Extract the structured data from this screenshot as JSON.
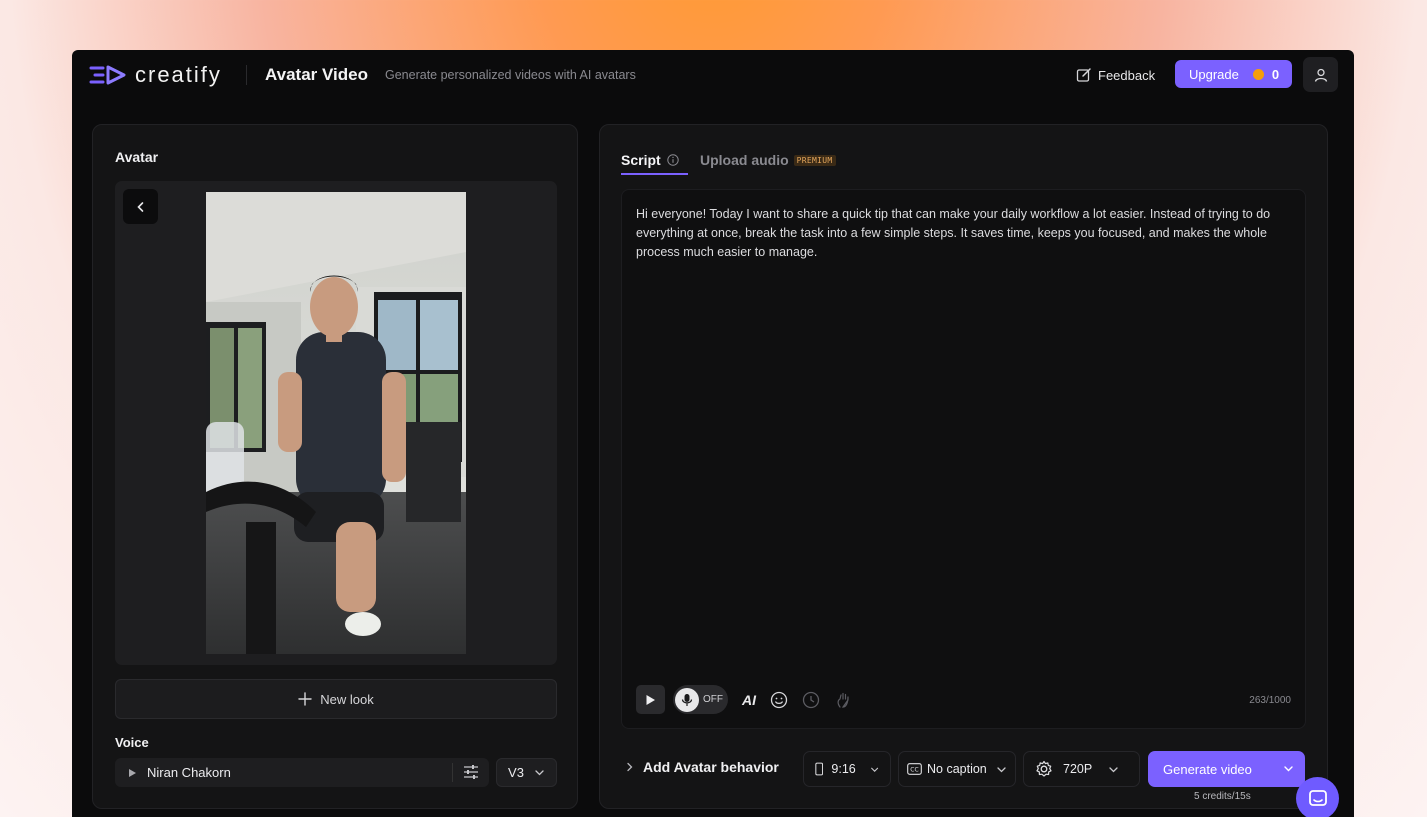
{
  "header": {
    "logo_text": "creatify",
    "title": "Avatar Video",
    "subtitle": "Generate personalized videos with AI avatars",
    "feedback_label": "Feedback",
    "upgrade_label": "Upgrade",
    "credits_count": "0"
  },
  "left": {
    "avatar_label": "Avatar",
    "new_look_label": "New look",
    "voice_label": "Voice",
    "voice_name": "Niran Chakorn",
    "voice_version": "V3"
  },
  "right": {
    "tabs": [
      {
        "label": "Script",
        "active": true
      },
      {
        "label": "Upload audio",
        "badge": "PREMIUM",
        "active": false
      }
    ],
    "script_text": "Hi everyone! Today I want to share a quick tip that can make your daily workflow a lot easier. Instead of trying to do everything at once, break the task into a few simple steps. It saves time, keeps you focused, and makes the whole process much easier to manage.",
    "mic_state": "OFF",
    "ai_label": "AI",
    "char_count": "263/1000",
    "behavior_label": "Add Avatar behavior",
    "aspect_ratio": "9:16",
    "caption": "No caption",
    "resolution": "720P",
    "generate_label": "Generate video",
    "credits_note": "5 credits/15s"
  },
  "colors": {
    "accent": "#7b61ff",
    "background": "#0b0b0c",
    "panel": "#141415"
  }
}
